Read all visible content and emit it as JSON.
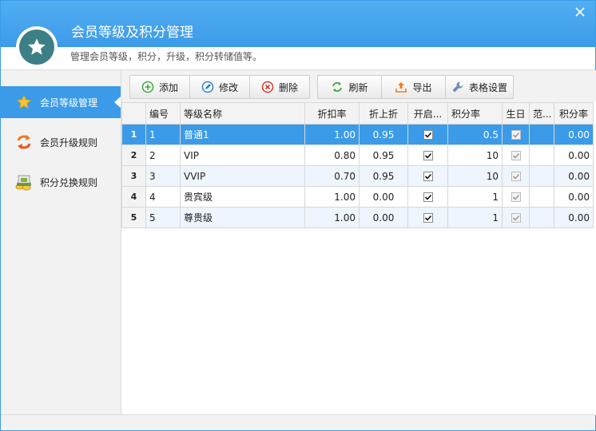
{
  "window": {
    "title": "会员等级及积分管理",
    "subtitle": "管理会员等级，积分，升级，积分转储值等。"
  },
  "colors": {
    "accent": "#3c9be8",
    "header": "#52aef2",
    "logo": "#3c7f86"
  },
  "sidebar": {
    "items": [
      {
        "label": "会员等级管理",
        "icon": "star-icon",
        "active": true
      },
      {
        "label": "会员升级规则",
        "icon": "exchange-arrows-icon",
        "active": false
      },
      {
        "label": "积分兑换规则",
        "icon": "gift-coins-icon",
        "active": false
      }
    ]
  },
  "toolbar": {
    "add": "添加",
    "edit": "修改",
    "delete": "删除",
    "refresh": "刷新",
    "export": "导出",
    "table_settings": "表格设置"
  },
  "table": {
    "columns": [
      "编号",
      "等级名称",
      "折扣率",
      "折上折",
      "开启...",
      "积分率",
      "生日",
      "范...",
      "积分率"
    ],
    "rows": [
      {
        "rownum": "1",
        "id": "1",
        "name": "普通1",
        "discount": "1.00",
        "extra": "0.95",
        "enabled": true,
        "points": "0.5",
        "birthday": true,
        "range": "",
        "points_rate": "0.00"
      },
      {
        "rownum": "2",
        "id": "2",
        "name": "VIP",
        "discount": "0.80",
        "extra": "0.95",
        "enabled": true,
        "points": "10",
        "birthday": true,
        "range": "",
        "points_rate": "0.00"
      },
      {
        "rownum": "3",
        "id": "3",
        "name": "VVIP",
        "discount": "0.70",
        "extra": "0.95",
        "enabled": true,
        "points": "10",
        "birthday": true,
        "range": "",
        "points_rate": "0.00"
      },
      {
        "rownum": "4",
        "id": "4",
        "name": "贵宾级",
        "discount": "1.00",
        "extra": "0.00",
        "enabled": true,
        "points": "1",
        "birthday": true,
        "range": "",
        "points_rate": "0.00"
      },
      {
        "rownum": "5",
        "id": "5",
        "name": "尊贵级",
        "discount": "1.00",
        "extra": "0.00",
        "enabled": true,
        "points": "1",
        "birthday": true,
        "range": "",
        "points_rate": "0.00"
      }
    ]
  }
}
